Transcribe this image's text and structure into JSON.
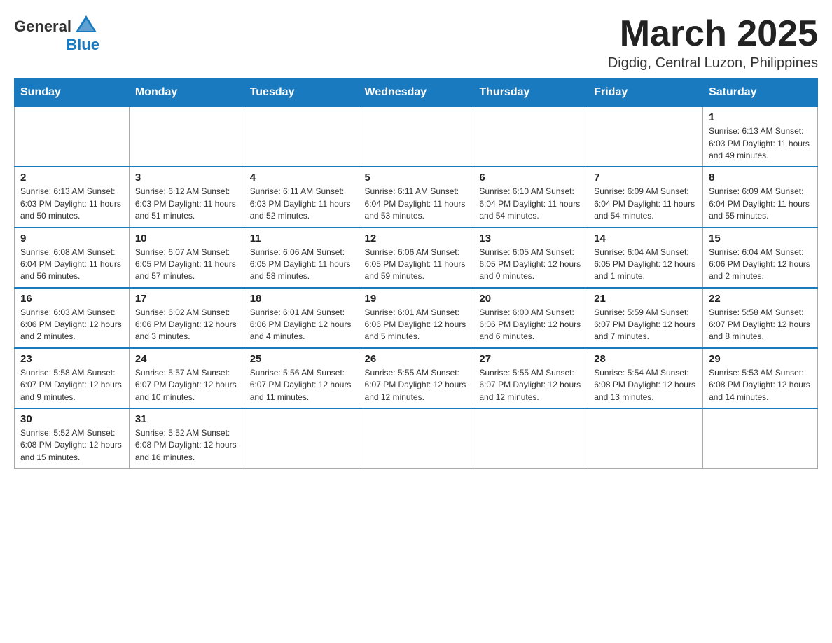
{
  "header": {
    "logo_general": "General",
    "logo_blue": "Blue",
    "month_title": "March 2025",
    "location": "Digdig, Central Luzon, Philippines"
  },
  "weekdays": [
    "Sunday",
    "Monday",
    "Tuesday",
    "Wednesday",
    "Thursday",
    "Friday",
    "Saturday"
  ],
  "weeks": [
    [
      {
        "day": "",
        "info": ""
      },
      {
        "day": "",
        "info": ""
      },
      {
        "day": "",
        "info": ""
      },
      {
        "day": "",
        "info": ""
      },
      {
        "day": "",
        "info": ""
      },
      {
        "day": "",
        "info": ""
      },
      {
        "day": "1",
        "info": "Sunrise: 6:13 AM\nSunset: 6:03 PM\nDaylight: 11 hours and 49 minutes."
      }
    ],
    [
      {
        "day": "2",
        "info": "Sunrise: 6:13 AM\nSunset: 6:03 PM\nDaylight: 11 hours and 50 minutes."
      },
      {
        "day": "3",
        "info": "Sunrise: 6:12 AM\nSunset: 6:03 PM\nDaylight: 11 hours and 51 minutes."
      },
      {
        "day": "4",
        "info": "Sunrise: 6:11 AM\nSunset: 6:03 PM\nDaylight: 11 hours and 52 minutes."
      },
      {
        "day": "5",
        "info": "Sunrise: 6:11 AM\nSunset: 6:04 PM\nDaylight: 11 hours and 53 minutes."
      },
      {
        "day": "6",
        "info": "Sunrise: 6:10 AM\nSunset: 6:04 PM\nDaylight: 11 hours and 54 minutes."
      },
      {
        "day": "7",
        "info": "Sunrise: 6:09 AM\nSunset: 6:04 PM\nDaylight: 11 hours and 54 minutes."
      },
      {
        "day": "8",
        "info": "Sunrise: 6:09 AM\nSunset: 6:04 PM\nDaylight: 11 hours and 55 minutes."
      }
    ],
    [
      {
        "day": "9",
        "info": "Sunrise: 6:08 AM\nSunset: 6:04 PM\nDaylight: 11 hours and 56 minutes."
      },
      {
        "day": "10",
        "info": "Sunrise: 6:07 AM\nSunset: 6:05 PM\nDaylight: 11 hours and 57 minutes."
      },
      {
        "day": "11",
        "info": "Sunrise: 6:06 AM\nSunset: 6:05 PM\nDaylight: 11 hours and 58 minutes."
      },
      {
        "day": "12",
        "info": "Sunrise: 6:06 AM\nSunset: 6:05 PM\nDaylight: 11 hours and 59 minutes."
      },
      {
        "day": "13",
        "info": "Sunrise: 6:05 AM\nSunset: 6:05 PM\nDaylight: 12 hours and 0 minutes."
      },
      {
        "day": "14",
        "info": "Sunrise: 6:04 AM\nSunset: 6:05 PM\nDaylight: 12 hours and 1 minute."
      },
      {
        "day": "15",
        "info": "Sunrise: 6:04 AM\nSunset: 6:06 PM\nDaylight: 12 hours and 2 minutes."
      }
    ],
    [
      {
        "day": "16",
        "info": "Sunrise: 6:03 AM\nSunset: 6:06 PM\nDaylight: 12 hours and 2 minutes."
      },
      {
        "day": "17",
        "info": "Sunrise: 6:02 AM\nSunset: 6:06 PM\nDaylight: 12 hours and 3 minutes."
      },
      {
        "day": "18",
        "info": "Sunrise: 6:01 AM\nSunset: 6:06 PM\nDaylight: 12 hours and 4 minutes."
      },
      {
        "day": "19",
        "info": "Sunrise: 6:01 AM\nSunset: 6:06 PM\nDaylight: 12 hours and 5 minutes."
      },
      {
        "day": "20",
        "info": "Sunrise: 6:00 AM\nSunset: 6:06 PM\nDaylight: 12 hours and 6 minutes."
      },
      {
        "day": "21",
        "info": "Sunrise: 5:59 AM\nSunset: 6:07 PM\nDaylight: 12 hours and 7 minutes."
      },
      {
        "day": "22",
        "info": "Sunrise: 5:58 AM\nSunset: 6:07 PM\nDaylight: 12 hours and 8 minutes."
      }
    ],
    [
      {
        "day": "23",
        "info": "Sunrise: 5:58 AM\nSunset: 6:07 PM\nDaylight: 12 hours and 9 minutes."
      },
      {
        "day": "24",
        "info": "Sunrise: 5:57 AM\nSunset: 6:07 PM\nDaylight: 12 hours and 10 minutes."
      },
      {
        "day": "25",
        "info": "Sunrise: 5:56 AM\nSunset: 6:07 PM\nDaylight: 12 hours and 11 minutes."
      },
      {
        "day": "26",
        "info": "Sunrise: 5:55 AM\nSunset: 6:07 PM\nDaylight: 12 hours and 12 minutes."
      },
      {
        "day": "27",
        "info": "Sunrise: 5:55 AM\nSunset: 6:07 PM\nDaylight: 12 hours and 12 minutes."
      },
      {
        "day": "28",
        "info": "Sunrise: 5:54 AM\nSunset: 6:08 PM\nDaylight: 12 hours and 13 minutes."
      },
      {
        "day": "29",
        "info": "Sunrise: 5:53 AM\nSunset: 6:08 PM\nDaylight: 12 hours and 14 minutes."
      }
    ],
    [
      {
        "day": "30",
        "info": "Sunrise: 5:52 AM\nSunset: 6:08 PM\nDaylight: 12 hours and 15 minutes."
      },
      {
        "day": "31",
        "info": "Sunrise: 5:52 AM\nSunset: 6:08 PM\nDaylight: 12 hours and 16 minutes."
      },
      {
        "day": "",
        "info": ""
      },
      {
        "day": "",
        "info": ""
      },
      {
        "day": "",
        "info": ""
      },
      {
        "day": "",
        "info": ""
      },
      {
        "day": "",
        "info": ""
      }
    ]
  ]
}
